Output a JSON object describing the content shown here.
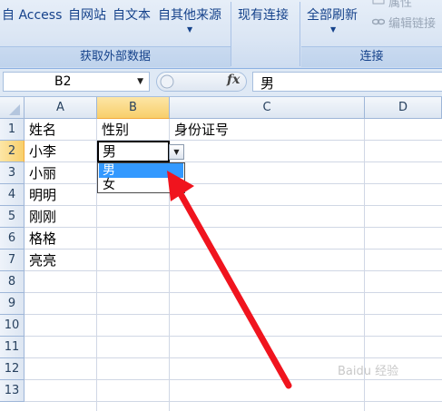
{
  "ribbon": {
    "buttons": [
      "自 Access",
      "自网站",
      "自文本",
      "自其他来源",
      "现有连接",
      "全部刷新"
    ],
    "small_buttons": [
      "属性",
      "编辑链接"
    ],
    "groups": [
      "获取外部数据",
      "连接"
    ]
  },
  "formula_bar": {
    "name_box": "B2",
    "fx": "fx",
    "value": "男"
  },
  "sheet": {
    "columns": [
      "A",
      "B",
      "C",
      "D"
    ],
    "rows": [
      "1",
      "2",
      "3",
      "4",
      "5",
      "6",
      "7",
      "8",
      "9",
      "10",
      "11",
      "12",
      "13"
    ],
    "active_cell": "B2",
    "headers": {
      "a1": "姓名",
      "b1": "性别",
      "c1": "身份证号"
    },
    "names": [
      "小李",
      "小丽",
      "明明",
      "刚刚",
      "格格",
      "亮亮"
    ],
    "b2_value": "男"
  },
  "dropdown": {
    "options": [
      "男",
      "女"
    ],
    "selected": "男"
  },
  "watermark": "Baidu 经验"
}
